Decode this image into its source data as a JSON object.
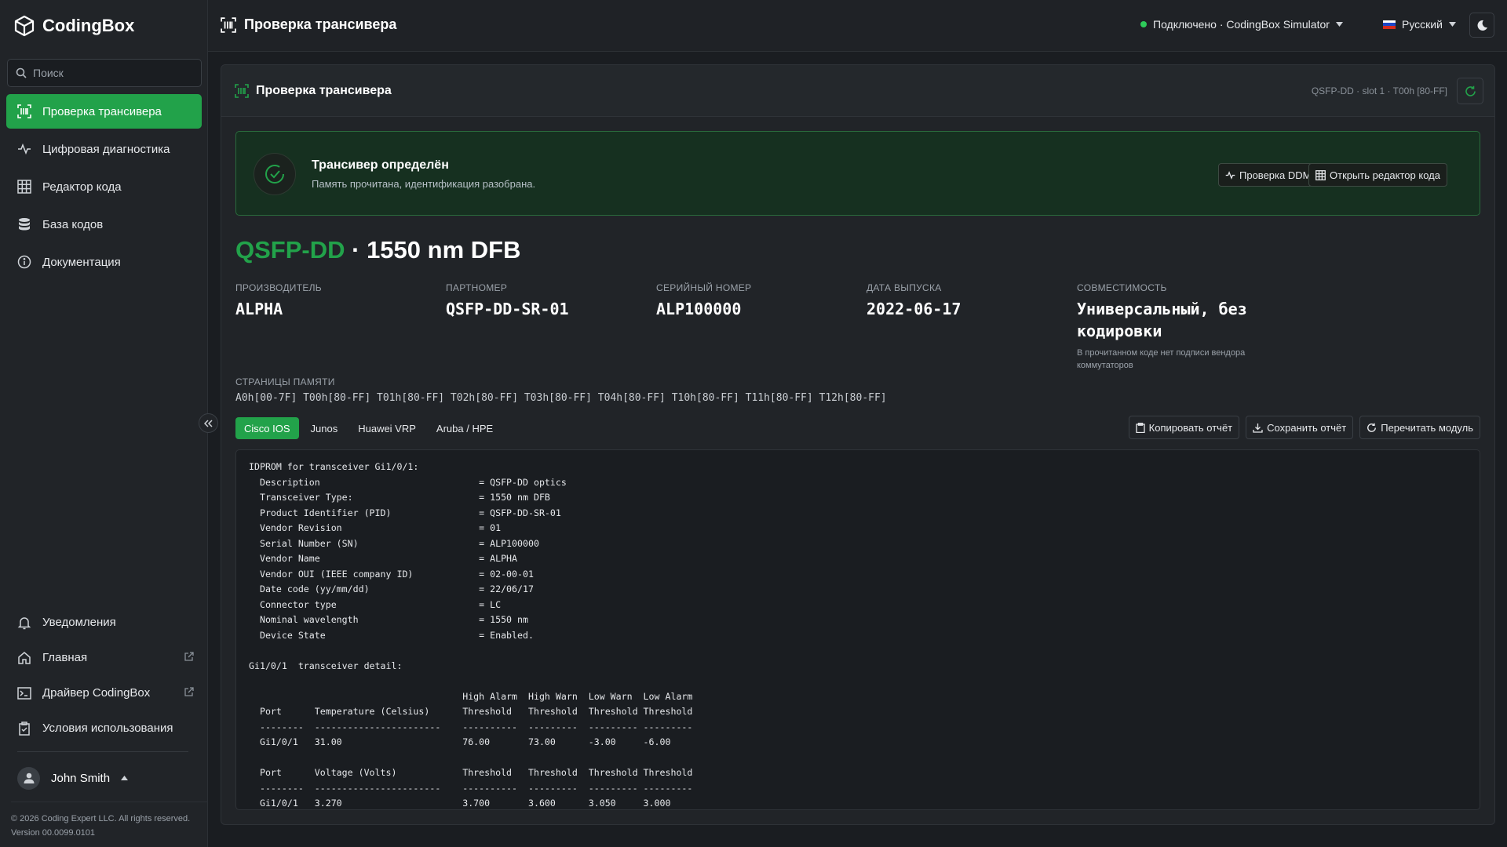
{
  "app": {
    "name": "CodingBox"
  },
  "search": {
    "placeholder": "Поиск"
  },
  "sidebar": {
    "items": [
      {
        "label": "Проверка трансивера"
      },
      {
        "label": "Цифровая диагностика"
      },
      {
        "label": "Редактор кода"
      },
      {
        "label": "База кодов"
      },
      {
        "label": "Документация"
      }
    ],
    "bottom_items": [
      {
        "label": "Уведомления"
      },
      {
        "label": "Главная"
      },
      {
        "label": "Драйвер CodingBox"
      },
      {
        "label": "Условия использования"
      }
    ],
    "user": {
      "name": "John Smith"
    },
    "copyright": "© 2026 Coding Expert LLC. All rights reserved.",
    "version": "Version 00.0099.0101"
  },
  "header": {
    "title": "Проверка трансивера",
    "connection": "Подключено · CodingBox Simulator",
    "language": "Русский"
  },
  "panel": {
    "title": "Проверка трансивера",
    "meta": "QSFP-DD · slot 1 · T00h [80-FF]"
  },
  "alert": {
    "title": "Трансивер определён",
    "subtitle": "Память прочитана, идентификация разобрана.",
    "ddm_button": "Проверка DDM",
    "editor_button": "Открыть редактор кода"
  },
  "module": {
    "form_factor": "QSFP-DD",
    "separator": " · ",
    "type": "1550 nm DFB"
  },
  "info": {
    "manufacturer_label": "Производитель",
    "manufacturer": "ALPHA",
    "part_label": "Партномер",
    "part": "QSFP-DD-SR-01",
    "serial_label": "Серийный номер",
    "serial": "ALP100000",
    "date_label": "Дата выпуска",
    "date": "2022-06-17",
    "compat_label": "Совместимость",
    "compat": "Универсальный, без кодировки",
    "compat_note": "В прочитанном коде нет подписи вендора коммутаторов"
  },
  "memory": {
    "label": "Страницы памяти",
    "pages": "A0h[00-7F] T00h[80-FF] T01h[80-FF] T02h[80-FF] T03h[80-FF] T04h[80-FF] T10h[80-FF] T11h[80-FF] T12h[80-FF]"
  },
  "tabs": [
    {
      "label": "Cisco IOS"
    },
    {
      "label": "Junos"
    },
    {
      "label": "Huawei VRP"
    },
    {
      "label": "Aruba / HPE"
    }
  ],
  "actions": {
    "copy": "Копировать отчёт",
    "save": "Сохранить отчёт",
    "reread": "Перечитать модуль"
  },
  "report": {
    "text": "IDPROM for transceiver Gi1/0/1:\n  Description                             = QSFP-DD optics\n  Transceiver Type:                       = 1550 nm DFB\n  Product Identifier (PID)                = QSFP-DD-SR-01\n  Vendor Revision                         = 01\n  Serial Number (SN)                      = ALP100000\n  Vendor Name                             = ALPHA\n  Vendor OUI (IEEE company ID)            = 02-00-01\n  Date code (yy/mm/dd)                    = 22/06/17\n  Connector type                          = LC\n  Nominal wavelength                      = 1550 nm\n  Device State                            = Enabled.\n\nGi1/0/1  transceiver detail:\n\n                                       High Alarm  High Warn  Low Warn  Low Alarm\n  Port      Temperature (Celsius)      Threshold   Threshold  Threshold Threshold\n  --------  -----------------------    ----------  ---------  --------- ---------\n  Gi1/0/1   31.00                      76.00       73.00      -3.00     -6.00\n\n  Port      Voltage (Volts)            Threshold   Threshold  Threshold Threshold\n  --------  -----------------------    ----------  ---------  --------- ---------\n  Gi1/0/1   3.270                      3.700       3.600      3.050     3.000"
  },
  "colors": {
    "accent": "#22a24a",
    "background": "#1a1d21",
    "sidebar": "#212428"
  }
}
